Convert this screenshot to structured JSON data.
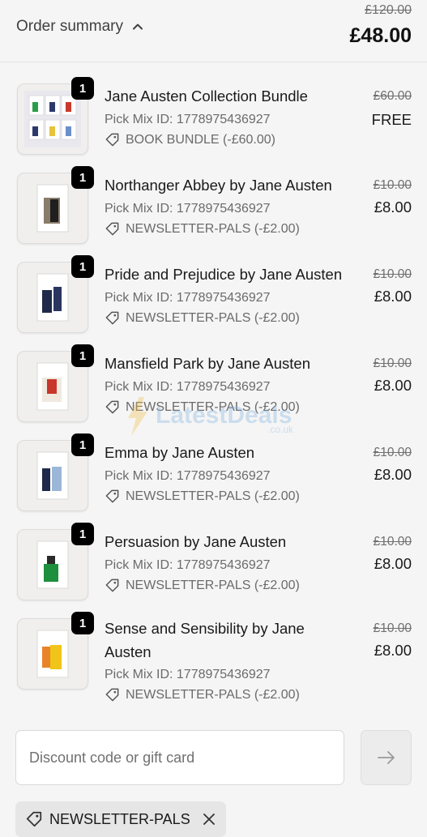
{
  "header": {
    "toggle_label": "Order summary",
    "original_total": "£120.00",
    "total": "£48.00"
  },
  "items": [
    {
      "qty": "1",
      "name": "Jane Austen Collection Bundle",
      "pick_mix": "Pick Mix ID: 1778975436927",
      "discount": "BOOK BUNDLE (-£60.00)",
      "original_price": "£60.00",
      "price": "FREE",
      "thumb": "bundle-grid"
    },
    {
      "qty": "1",
      "name": "Northanger Abbey by Jane Austen",
      "pick_mix": "Pick Mix ID: 1778975436927",
      "discount": "NEWSLETTER-PALS (-£2.00)",
      "original_price": "£10.00",
      "price": "£8.00",
      "thumb": "book-cover"
    },
    {
      "qty": "1",
      "name": "Pride and Prejudice by Jane Austen",
      "pick_mix": "Pick Mix ID: 1778975436927",
      "discount": "NEWSLETTER-PALS (-£2.00)",
      "original_price": "£10.00",
      "price": "£8.00",
      "thumb": "book-cover"
    },
    {
      "qty": "1",
      "name": "Mansfield Park by Jane Austen",
      "pick_mix": "Pick Mix ID: 1778975436927",
      "discount": "NEWSLETTER-PALS (-£2.00)",
      "original_price": "£10.00",
      "price": "£8.00",
      "thumb": "book-cover"
    },
    {
      "qty": "1",
      "name": "Emma by Jane Austen",
      "pick_mix": "Pick Mix ID: 1778975436927",
      "discount": "NEWSLETTER-PALS (-£2.00)",
      "original_price": "£10.00",
      "price": "£8.00",
      "thumb": "book-cover"
    },
    {
      "qty": "1",
      "name": "Persuasion by Jane Austen",
      "pick_mix": "Pick Mix ID: 1778975436927",
      "discount": "NEWSLETTER-PALS (-£2.00)",
      "original_price": "£10.00",
      "price": "£8.00",
      "thumb": "book-cover"
    },
    {
      "qty": "1",
      "name": "Sense and Sensibility by Jane Austen",
      "pick_mix": "Pick Mix ID: 1778975436927",
      "discount": "NEWSLETTER-PALS (-£2.00)",
      "original_price": "£10.00",
      "price": "£8.00",
      "thumb": "book-cover"
    }
  ],
  "discount_field": {
    "placeholder": "Discount code or gift card"
  },
  "applied_code": {
    "label": "NEWSLETTER-PALS"
  },
  "watermark": {
    "brand": "LatestDeals",
    "domain": ".co.uk"
  },
  "icons": {
    "toggle": "chevron-up-icon",
    "tag": "tag-icon",
    "apply": "arrow-right-icon",
    "remove": "close-icon"
  },
  "colors": {
    "badge": "#000000",
    "total": "#111111",
    "muted": "#6b6b6b"
  }
}
